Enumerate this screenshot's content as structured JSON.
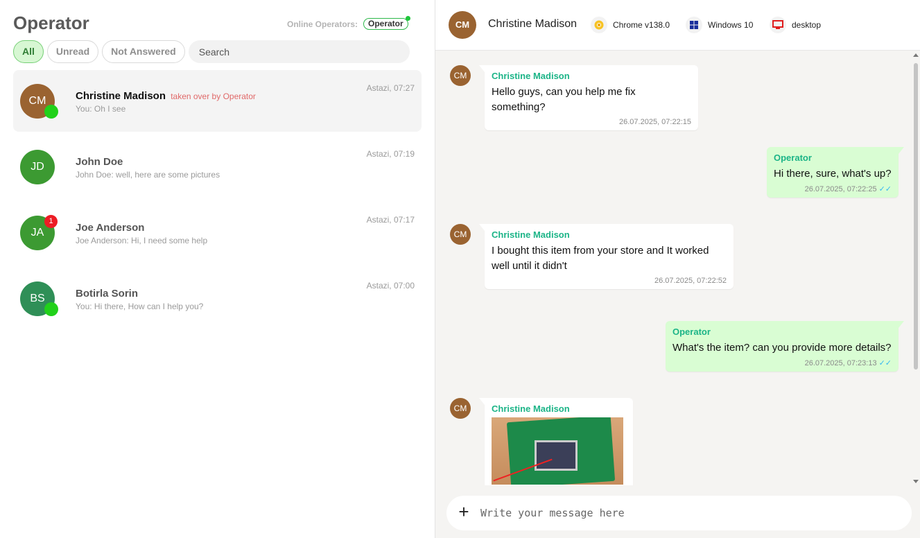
{
  "app": {
    "title": "Operator"
  },
  "online": {
    "label": "Online Operators:",
    "operator": "Operator"
  },
  "filters": [
    {
      "label": "All",
      "active": true
    },
    {
      "label": "Unread",
      "active": false
    },
    {
      "label": "Not Answered",
      "active": false
    }
  ],
  "search": {
    "placeholder": "Search"
  },
  "conversations": [
    {
      "initials": "CM",
      "name": "Christine Madison",
      "taken": "taken over by Operator",
      "preview": "You: Oh I see",
      "time": "Astazi, 07:27",
      "avatar_color": "#9a6331",
      "online": true
    },
    {
      "initials": "JD",
      "name": "John Doe",
      "taken": "",
      "preview": "John Doe: well, here are some pictures",
      "time": "Astazi, 07:19",
      "avatar_color": "#3c9a32",
      "online": false
    },
    {
      "initials": "JA",
      "name": "Joe Anderson",
      "taken": "",
      "preview": "Joe Anderson: Hi, I need some help",
      "time": "Astazi, 07:17",
      "avatar_color": "#3c9a32",
      "online": false,
      "unread": "1"
    },
    {
      "initials": "BS",
      "name": "Botirla Sorin",
      "taken": "",
      "preview": "You: Hi there, How can I help you?",
      "time": "Astazi, 07:00",
      "avatar_color": "#2f8f57",
      "online": true
    }
  ],
  "chat": {
    "initials": "CM",
    "name": "Christine Madison",
    "browser": "Chrome v138.0",
    "os": "Windows 10",
    "device": "desktop",
    "messages": [
      {
        "sender": "Christine Madison",
        "text": "Hello guys, can you help me fix something?",
        "time": "26.07.2025, 07:22:15",
        "direction": "in"
      },
      {
        "sender": "Operator",
        "text": "Hi there, sure, what's up?",
        "time": "26.07.2025, 07:22:25",
        "direction": "out"
      },
      {
        "sender": "Christine Madison",
        "text": "I bought this item from your store and It worked well until it didn't",
        "time": "26.07.2025, 07:22:52",
        "direction": "in"
      },
      {
        "sender": "Operator",
        "text": "What's the item? can you provide more details?",
        "time": "26.07.2025, 07:23:13",
        "direction": "out"
      },
      {
        "sender": "Christine Madison",
        "text": "",
        "time": "",
        "direction": "in",
        "image": "circuit-board-photo"
      }
    ]
  },
  "composer": {
    "placeholder": "Write your message here"
  },
  "colors": {
    "accent_green": "#1bb487",
    "outgoing_bubble": "#d9fdd3",
    "chat_bg": "#f5f4f2",
    "online_green": "#21d11a",
    "unread_red": "#ec1c24"
  }
}
